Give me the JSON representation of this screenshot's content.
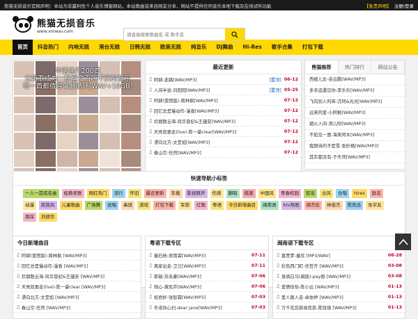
{
  "topbar": {
    "notice": "熊猫无损音乐官网声明：本站为非赢利性个人音乐博客网站，本站歌曲皆来自网友分享，网站不提供任何音乐本地下载及在线试听功能",
    "links": "【免责声明】",
    "user": "注册|登录"
  },
  "header": {
    "logo_title": "熊猫无损音乐",
    "logo_url": "www.xmwav.com",
    "search_placeholder": "请直接搜索歌曲名 或 歌手名",
    "search_icon": "search-icon"
  },
  "nav": {
    "items": [
      "首页",
      "抖音热门",
      "内地无损",
      "港台无损",
      "日韩无损",
      "欧美无损",
      "纯音乐",
      "DJ舞曲",
      "Hi-Res",
      "歌手合集",
      "打包下载"
    ]
  },
  "banner": {
    "line1": "华语佳作200首",
    "line2": "让听歌成为一种享受百听不厌的音乐",
    "line3": "每一首都值得单曲循环[WAV+10GB]"
  },
  "latest": {
    "title": "最近更新",
    "rows": [
      {
        "title": "阿肆-走路[WAV/MP3]",
        "tag": "[置顶]",
        "date": "06-12"
      },
      {
        "title": "人间半途-刘阳阳[WAV/MP3]",
        "tag": "[置顶]",
        "date": "05-25"
      },
      {
        "title": "阿肆(爱困版)-周林枫[WAV/MP3]",
        "tag": "",
        "date": "07-12"
      },
      {
        "title": "回忆总是慢动作-漫香[WAV/MP3]",
        "tag": "",
        "date": "07-12"
      },
      {
        "title": "炊烟散云海-风华曾纪&王蕴安[WAV/MP3]",
        "tag": "",
        "date": "07-12"
      },
      {
        "title": "天亮就要走(live)-陈一豪clear[WAV/MP3]",
        "tag": "",
        "date": "07-12"
      },
      {
        "title": "漂向北方-文昰如[WAV/MP3]",
        "tag": "",
        "date": "07-12"
      },
      {
        "title": "春山空-任然[WAV/MP3]",
        "tag": "",
        "date": "07-12"
      }
    ]
  },
  "sidebar": {
    "tabs": [
      "熊猫推荐",
      "热门排行",
      "网站公告"
    ],
    "rows": [
      "西楼儿女-岳云鹏[WAV/MP3]",
      "多幸运遇见你-李乐乐[WAV/MP3]",
      "飞向别人的床-沉珂&光光[WAV/MP3]",
      "远来的爱-小阿枫[WAV/MP3]",
      "烟火人间-添儿呗[WAV/MP3]",
      "不如见一面-海来阿木[WAV/MP3]",
      "我期待的不是雪-张妙格[WAV/MP3]",
      "其实都没有-于冬然[WAV/MP3]"
    ]
  },
  "quick": {
    "title": "快速导航小标签",
    "tags": [
      {
        "label": "一人一首成名曲",
        "color": "#b9d86a"
      },
      {
        "label": "经典老歌",
        "color": "#f6b4c8"
      },
      {
        "label": "网红热门",
        "color": "#ffd966"
      },
      {
        "label": "流行",
        "color": "#9bd3f0"
      },
      {
        "label": "怀旧",
        "color": "#f7e27a"
      },
      {
        "label": "最近更新",
        "color": "#ffb3a7"
      },
      {
        "label": "车载",
        "color": "#ffd9a8"
      },
      {
        "label": "影视原声",
        "color": "#d6b7e8"
      },
      {
        "label": "伤感",
        "color": "#ffe599"
      },
      {
        "label": "翻唱",
        "color": "#a9e4c1"
      },
      {
        "label": "摇滚",
        "color": "#f4a9b0"
      },
      {
        "label": "中国风",
        "color": "#ffe28a"
      },
      {
        "label": "青春校园",
        "color": "#f6b4c8"
      },
      {
        "label": "民谣",
        "color": "#b9d86a"
      },
      {
        "label": "古风",
        "color": "#f7e27a"
      },
      {
        "label": "合唱",
        "color": "#9bd3f0"
      },
      {
        "label": "hires",
        "color": "#ffd966"
      },
      {
        "label": "励志",
        "color": "#ffb3a7"
      },
      {
        "label": "动漫",
        "color": "#ffe599"
      },
      {
        "label": "民族风",
        "color": "#d6b7e8"
      },
      {
        "label": "儿童歌曲",
        "color": "#ffd966"
      },
      {
        "label": "广场舞",
        "color": "#b9d86a"
      },
      {
        "label": "说唱",
        "color": "#9bd3f0"
      },
      {
        "label": "串烧",
        "color": "#ffd9a8"
      },
      {
        "label": "游戏",
        "color": "#f7e27a"
      },
      {
        "label": "打包下载",
        "color": "#ffb3a7"
      },
      {
        "label": "军旅",
        "color": "#ffe599"
      },
      {
        "label": "红歌",
        "color": "#f6b4c8"
      },
      {
        "label": "粤语",
        "color": "#f7e27a"
      },
      {
        "label": "今日新增曲目",
        "color": "#ffd966"
      },
      {
        "label": "闽南语",
        "color": "#a9e4c1"
      },
      {
        "label": "ktv热歌",
        "color": "#d6b7e8"
      },
      {
        "label": "周杰伦",
        "color": "#ffb3a7"
      },
      {
        "label": "林俊杰",
        "color": "#ffd9a8"
      },
      {
        "label": "陈奕迅",
        "color": "#9bd3f0"
      },
      {
        "label": "张学友",
        "color": "#ffe599"
      },
      {
        "label": "周深",
        "color": "#f6b4c8"
      },
      {
        "label": "刘德华",
        "color": "#ffd966"
      }
    ]
  },
  "today": {
    "title": "今日新增曲目",
    "rows": [
      {
        "title": "阿肆(爱困版)-周林枫 [WAV/MP3]",
        "date": ""
      },
      {
        "title": "回忆总是慢动作-漫香 [WAV/MP3]",
        "date": ""
      },
      {
        "title": "炊烟散云海-风华曾纪&王蕴安 [WAV/MP3]",
        "date": ""
      },
      {
        "title": "天亮就要走(live)-陈一豪clear [WAV/MP3]",
        "date": ""
      },
      {
        "title": "漂向北方-文昰如 [WAV/MP3]",
        "date": ""
      },
      {
        "title": "春山空-任然 [WAV/MP3]",
        "date": ""
      }
    ]
  },
  "cantonese": {
    "title": "粤语下载专区",
    "rows": [
      {
        "title": "瘦石杨-吴雨霏[WAV/MP3]",
        "date": "07-11"
      },
      {
        "title": "离家出走-卫兰[WAV/MP3]",
        "date": "07-11"
      },
      {
        "title": "耶褪-苏永康[WAV/MP3]",
        "date": "07-06"
      },
      {
        "title": "倾心-黄凯芹[WAV/MP3]",
        "date": "07-06"
      },
      {
        "title": "祝君好-张智霖[WAV/MP3]",
        "date": "07-03"
      },
      {
        "title": "冬诺你心扫-dear jane[WAV/MP3]",
        "date": "07-03"
      }
    ]
  },
  "minnan": {
    "title": "闽南语下载专区",
    "rows": [
      {
        "title": "富贵梦-童欣 [MP3/WAV]",
        "date": "06-28"
      },
      {
        "title": "彩色西门町-任签齐 [WAV/MP3]",
        "date": "03-08"
      },
      {
        "title": "身骑白马(闽版)-pay姐 [WAV/MP3]",
        "date": "03-08"
      },
      {
        "title": "爱情恰恰-陈小云 [WAV/MP3]",
        "date": "01-13"
      },
      {
        "title": "爱人跟人走-卓依婷 [WAV/MP3]",
        "date": "01-13"
      },
      {
        "title": "万千花蕊慈母悲哀-陈玟瑄 [WAV/MP3]",
        "date": "01-13"
      }
    ]
  },
  "colors": {
    "accent": "#ffd800",
    "dark": "#111111",
    "date_red": "#c4002b",
    "tag_blue": "#1565c0"
  }
}
